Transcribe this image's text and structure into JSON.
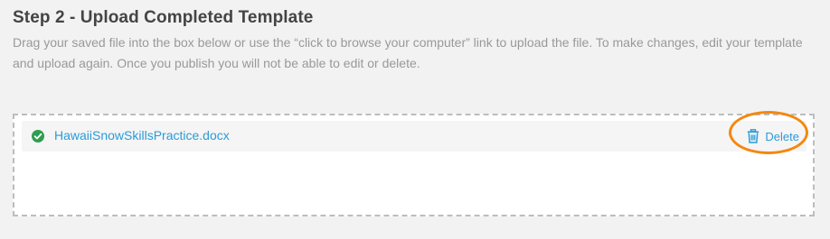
{
  "step": {
    "title": "Step 2 - Upload Completed Template",
    "description": "Drag your saved file into the box below or use the “click to browse your computer” link to upload the file. To make changes, edit your template and upload again. Once you publish you will not be able to edit or delete."
  },
  "upload": {
    "file_name": "HawaiiSnowSkillsPractice.docx",
    "status_icon": "check-circle-icon",
    "delete_label": "Delete",
    "delete_icon": "trash-icon"
  },
  "colors": {
    "link": "#2a9bd8",
    "success": "#2e9e4f",
    "highlight": "#f5870f"
  }
}
